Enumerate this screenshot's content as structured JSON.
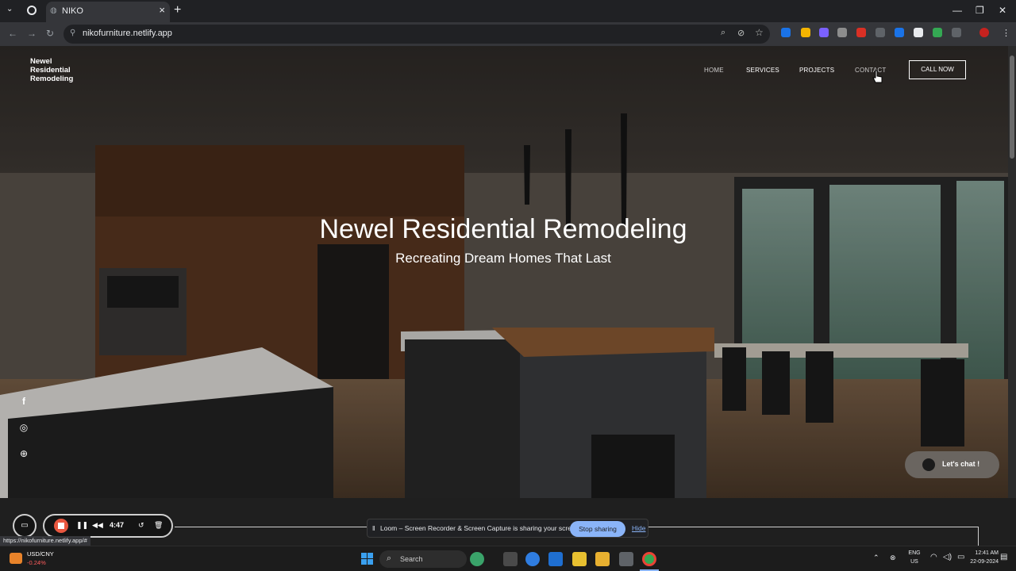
{
  "browser": {
    "tab_title": "NIKO",
    "url": "nikofurniture.netlify.app",
    "status_url": "https://nikofurniture.netlify.app/#"
  },
  "site": {
    "brand": [
      "Newel",
      "Residential",
      "Remodeling"
    ],
    "nav": [
      "HOME",
      "SERVICES",
      "PROJECTS",
      "CONTACT"
    ],
    "cta": "CALL NOW",
    "hero_title": "Newel Residential Remodeling",
    "hero_subtitle": "Recreating Dream Homes That Last",
    "chat_label": "Let's chat !",
    "social_icons": [
      "facebook-icon",
      "instagram-icon",
      "globe-icon"
    ]
  },
  "loom": {
    "timer": "4:47",
    "share_message": "Loom – Screen Recorder & Screen Capture is sharing your screen.",
    "stop_sharing": "Stop sharing",
    "hide": "Hide"
  },
  "taskbar": {
    "ticker_name": "USD/CNY",
    "ticker_change": "-0.24%",
    "search_placeholder": "Search",
    "lang_top": "ENG",
    "lang_bottom": "US",
    "time": "12:41 AM",
    "date": "22-09-2024"
  },
  "colors": {
    "accent_red": "#e9573f",
    "link_blue": "#8ab4f8",
    "ticker_red": "#ff5c5c"
  }
}
